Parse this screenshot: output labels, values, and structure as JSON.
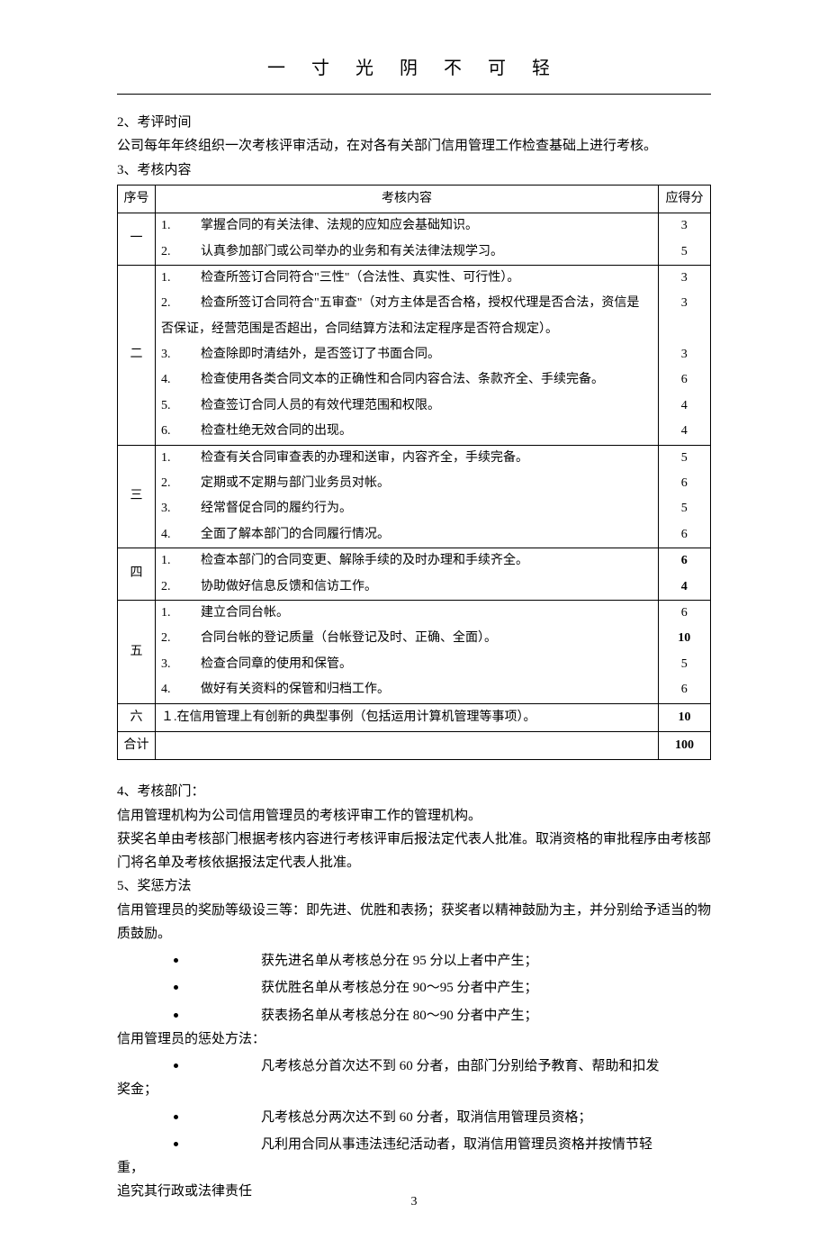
{
  "header_title": "一 寸 光 阴 不 可 轻",
  "intro": {
    "line1": "2、考评时间",
    "line2": "公司每年年终组织一次考核评审活动，在对各有关部门信用管理工作检查基础上进行考核。",
    "line3": "3、考核内容"
  },
  "table": {
    "head": {
      "seq": "序号",
      "content": "考核内容",
      "score": "应得分"
    },
    "sections": [
      {
        "seq": "一",
        "items": [
          {
            "num": "1.",
            "text": "掌握合同的有关法律、法规的应知应会基础知识。",
            "score": "3",
            "bold": false
          },
          {
            "num": "2.",
            "text": "认真参加部门或公司举办的业务和有关法律法规学习。",
            "score": "5",
            "bold": false
          }
        ]
      },
      {
        "seq": "二",
        "items": [
          {
            "num": "1.",
            "text": "检查所签订合同符合\"三性\"（合法性、真实性、可行性）。",
            "score": "3",
            "bold": false
          },
          {
            "num": "2.",
            "text": "检查所签订合同符合\"五审查\"（对方主体是否合格，授权代理是否合法，资信是",
            "score": "3",
            "bold": false
          },
          {
            "num": "",
            "text": "否保证，经营范围是否超出，合同结算方法和法定程序是否符合规定）。",
            "score": "",
            "bold": false,
            "nonum": true
          },
          {
            "num": "3.",
            "text": "检查除即时清结外，是否签订了书面合同。",
            "score": "3",
            "bold": false
          },
          {
            "num": "4.",
            "text": "检查使用各类合同文本的正确性和合同内容合法、条款齐全、手续完备。",
            "score": "6",
            "bold": false
          },
          {
            "num": "5.",
            "text": "检查签订合同人员的有效代理范围和权限。",
            "score": "4",
            "bold": false
          },
          {
            "num": "6.",
            "text": "检查杜绝无效合同的出现。",
            "score": "4",
            "bold": false
          }
        ]
      },
      {
        "seq": "三",
        "items": [
          {
            "num": "1.",
            "text": "检查有关合同审查表的办理和送审，内容齐全，手续完备。",
            "score": "5",
            "bold": false
          },
          {
            "num": "2.",
            "text": "定期或不定期与部门业务员对帐。",
            "score": "6",
            "bold": false
          },
          {
            "num": "3.",
            "text": "经常督促合同的履约行为。",
            "score": "5",
            "bold": false
          },
          {
            "num": "4.",
            "text": "全面了解本部门的合同履行情况。",
            "score": "6",
            "bold": false
          }
        ]
      },
      {
        "seq": "四",
        "items": [
          {
            "num": "1.",
            "text": "检查本部门的合同变更、解除手续的及时办理和手续齐全。",
            "score": "6",
            "bold": true
          },
          {
            "num": "2.",
            "text": "协助做好信息反馈和信访工作。",
            "score": "4",
            "bold": true
          }
        ]
      },
      {
        "seq": "五",
        "items": [
          {
            "num": "1.",
            "text": "建立合同台帐。",
            "score": "6",
            "bold": false
          },
          {
            "num": "2.",
            "text": "合同台帐的登记质量（台帐登记及时、正确、全面）。",
            "score": "10",
            "bold": true
          },
          {
            "num": "3.",
            "text": "检查合同章的使用和保管。",
            "score": "5",
            "bold": false
          },
          {
            "num": "4.",
            "text": "做好有关资料的保管和归档工作。",
            "score": "6",
            "bold": false
          }
        ]
      },
      {
        "seq": "六",
        "plain": "１.在信用管理上有创新的典型事例（包括运用计算机管理等事项）。",
        "score": "10",
        "bold": true
      }
    ],
    "total": {
      "label": "合计",
      "score": "100",
      "bold": true
    }
  },
  "after": {
    "p1": "4、考核部门：",
    "p2": "信用管理机构为公司信用管理员的考核评审工作的管理机构。",
    "p3": "获奖名单由考核部门根据考核内容进行考核评审后报法定代表人批准。取消资格的审批程序由考核部门将名单及考核依据报法定代表人批准。",
    "p4": "5、奖惩方法",
    "p5": "信用管理员的奖励等级设三等：即先进、优胜和表扬；获奖者以精神鼓励为主，并分别给予适当的物质鼓励。",
    "bullets1": [
      "获先进名单从考核总分在 95 分以上者中产生；",
      "获优胜名单从考核总分在 90～95 分者中产生；",
      "获表扬名单从考核总分在 80～90 分者中产生；"
    ],
    "p6": "信用管理员的惩处方法：",
    "bullets2": [
      "凡考核总分首次达不到 60 分者，由部门分别给予教育、帮助和扣发"
    ],
    "p7": "奖金；",
    "bullets3": [
      "凡考核总分两次达不到 60 分者，取消信用管理员资格；",
      "凡利用合同从事违法违纪活动者，取消信用管理员资格并按情节轻"
    ],
    "p8": "重，",
    "p9": "追究其行政或法律责任"
  },
  "page_number": "3"
}
